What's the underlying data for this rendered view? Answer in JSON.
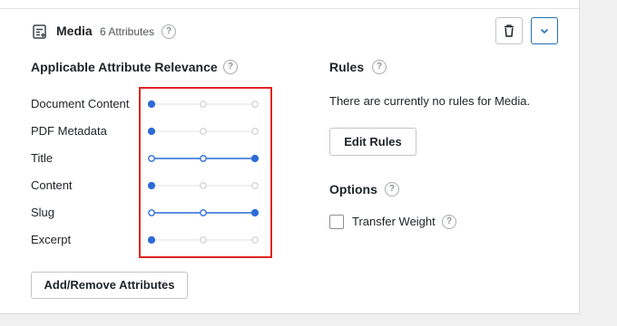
{
  "header": {
    "icon": "list-edit-icon",
    "title": "Media",
    "attribute_count": "6 Attributes",
    "help_glyph": "?"
  },
  "relevance": {
    "title": "Applicable Attribute Relevance",
    "attributes": [
      {
        "label": "Document Content",
        "level": 1
      },
      {
        "label": "PDF Metadata",
        "level": 1
      },
      {
        "label": "Title",
        "level": 3
      },
      {
        "label": "Content",
        "level": 1
      },
      {
        "label": "Slug",
        "level": 3
      },
      {
        "label": "Excerpt",
        "level": 1
      }
    ],
    "max_level": 3,
    "add_remove_button": "Add/Remove Attributes"
  },
  "rules": {
    "title": "Rules",
    "empty_message": "There are currently no rules for Media.",
    "edit_button": "Edit Rules"
  },
  "options": {
    "title": "Options",
    "transfer_weight_label": "Transfer Weight",
    "transfer_weight_checked": false
  },
  "colors": {
    "accent": "#2c6bd8",
    "track_inactive": "#e6e6e6",
    "stop_inactive": "#c8c8c8",
    "highlight": "#e02424"
  }
}
